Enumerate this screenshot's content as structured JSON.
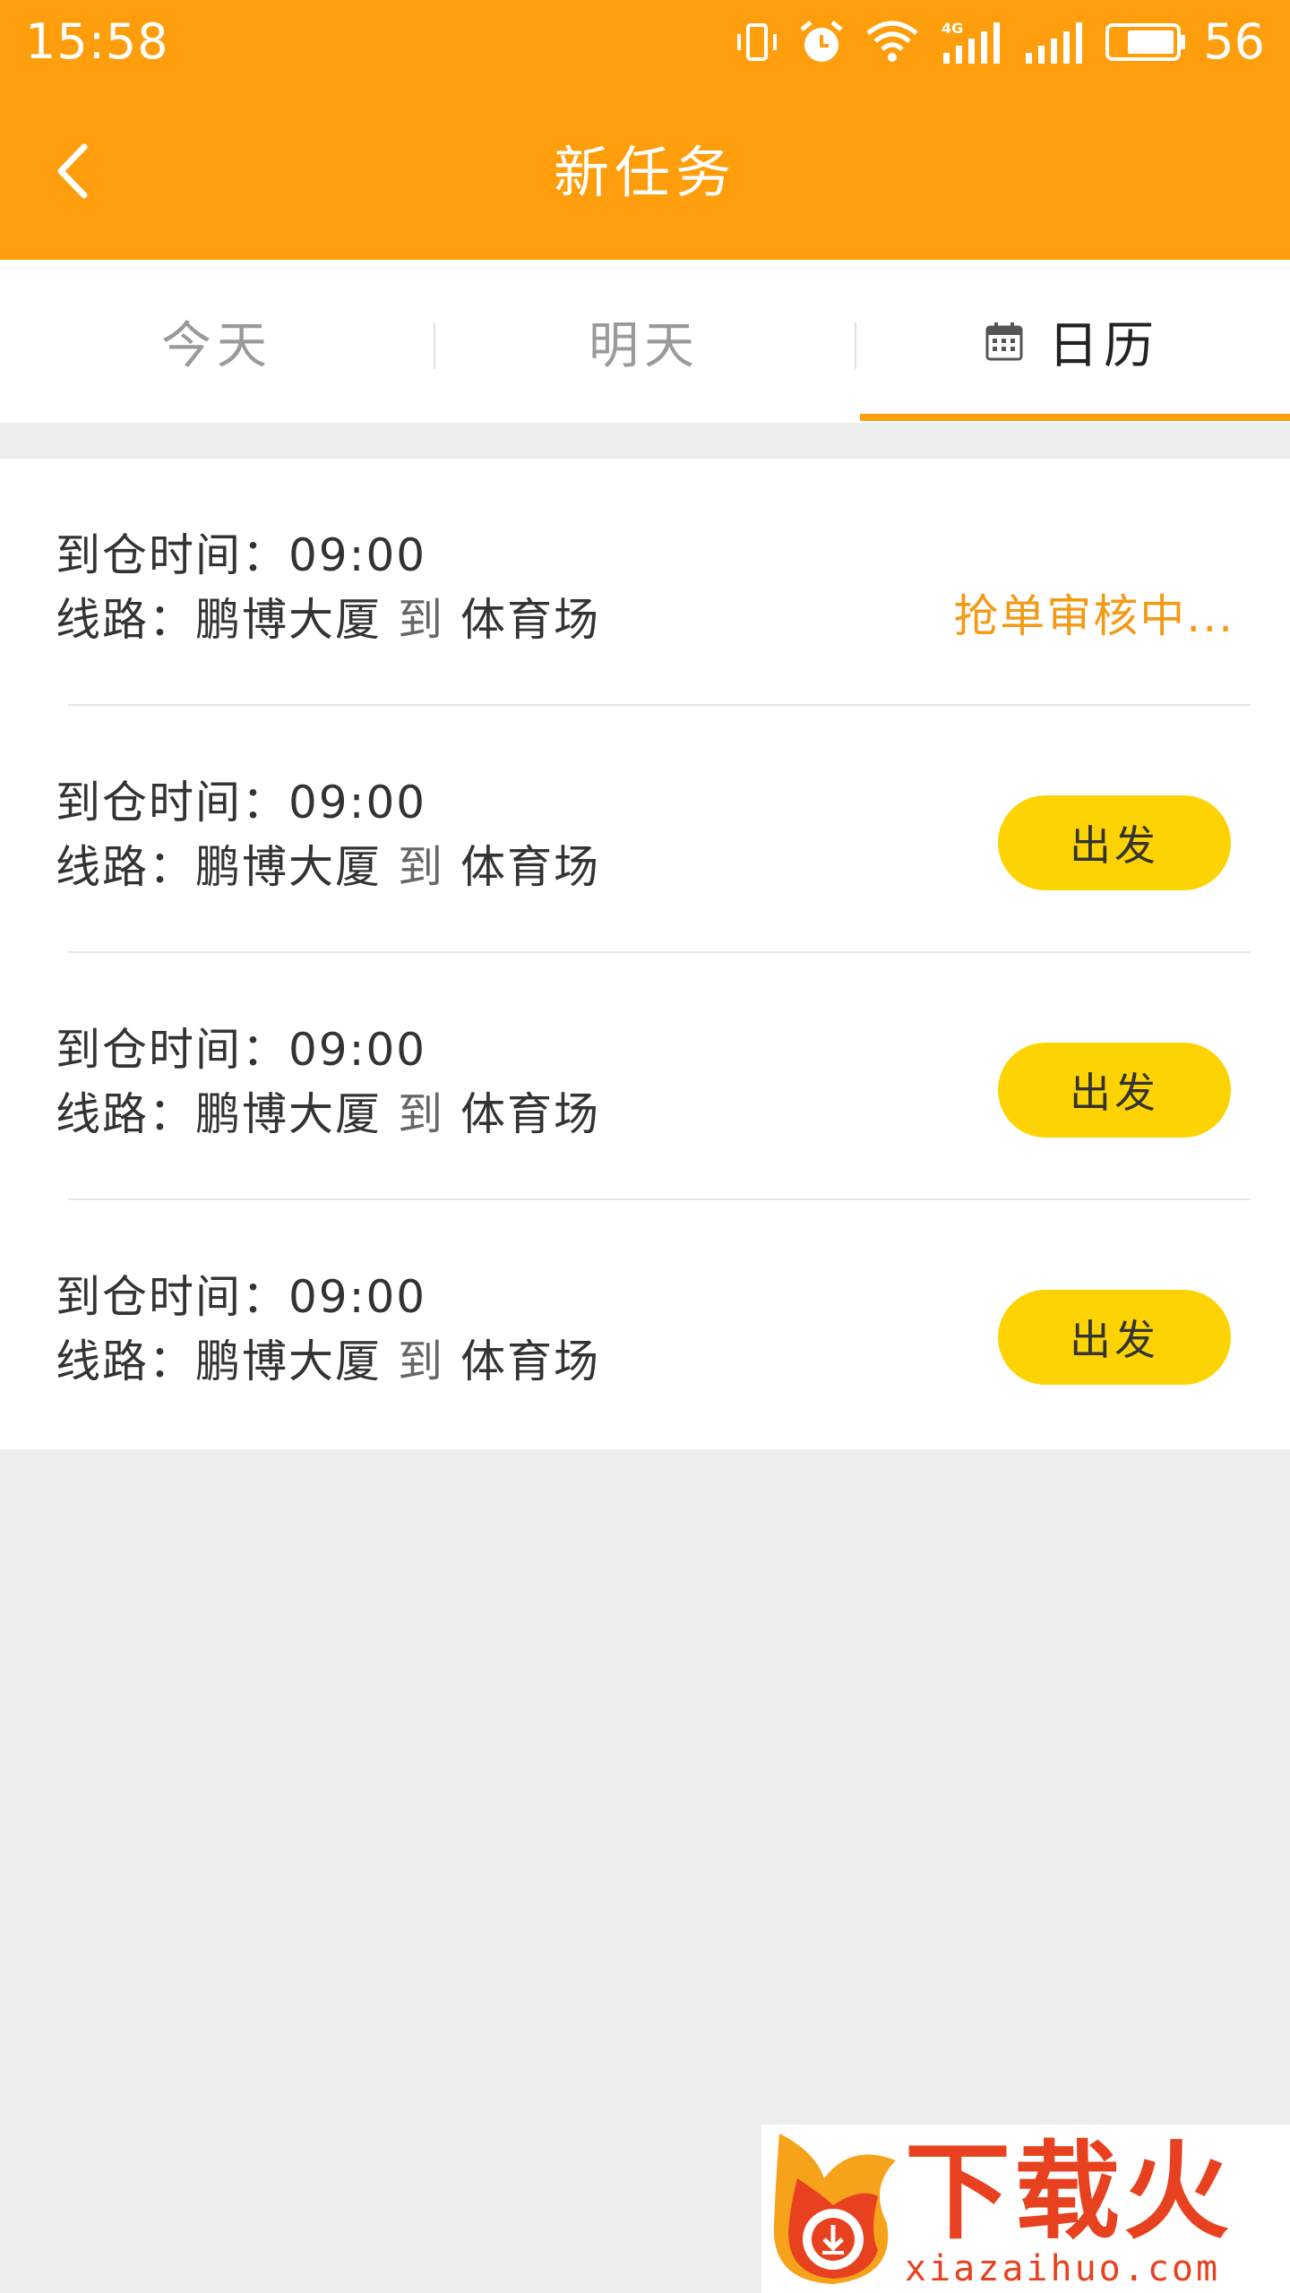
{
  "status_bar": {
    "time": "15:58",
    "battery_level": "56",
    "icons": [
      "vibrate-icon",
      "alarm-icon",
      "wifi-icon",
      "signal-4g-icon",
      "signal-icon",
      "battery-icon"
    ]
  },
  "header": {
    "title": "新任务",
    "back_icon": "chevron-left-icon"
  },
  "tabs": [
    {
      "label": "今天",
      "active": false
    },
    {
      "label": "明天",
      "active": false
    },
    {
      "label": "日历",
      "active": true,
      "icon": "calendar-icon"
    }
  ],
  "tasks": [
    {
      "arrival_label": "到仓时间：",
      "arrival_time": "09:00",
      "route_label": "线路：",
      "from": "鹏博大厦",
      "to_word": "到",
      "to": "体育场",
      "status_text": "抢单审核中..."
    },
    {
      "arrival_label": "到仓时间：",
      "arrival_time": "09:00",
      "route_label": "线路：",
      "from": "鹏博大厦",
      "to_word": "到",
      "to": "体育场",
      "action_label": "出发"
    },
    {
      "arrival_label": "到仓时间：",
      "arrival_time": "09:00",
      "route_label": "线路：",
      "from": "鹏博大厦",
      "to_word": "到",
      "to": "体育场",
      "action_label": "出发"
    },
    {
      "arrival_label": "到仓时间：",
      "arrival_time": "09:00",
      "route_label": "线路：",
      "from": "鹏博大厦",
      "to_word": "到",
      "to": "体育场",
      "action_label": "出发"
    }
  ],
  "watermark": {
    "brand": "下载火",
    "url": "xiazaihuo.com"
  },
  "colors": {
    "header": "#FE9E0C",
    "accent": "#FE9E0C",
    "button": "#FED303",
    "pending": "#F39A16",
    "background": "#ECEDED"
  }
}
